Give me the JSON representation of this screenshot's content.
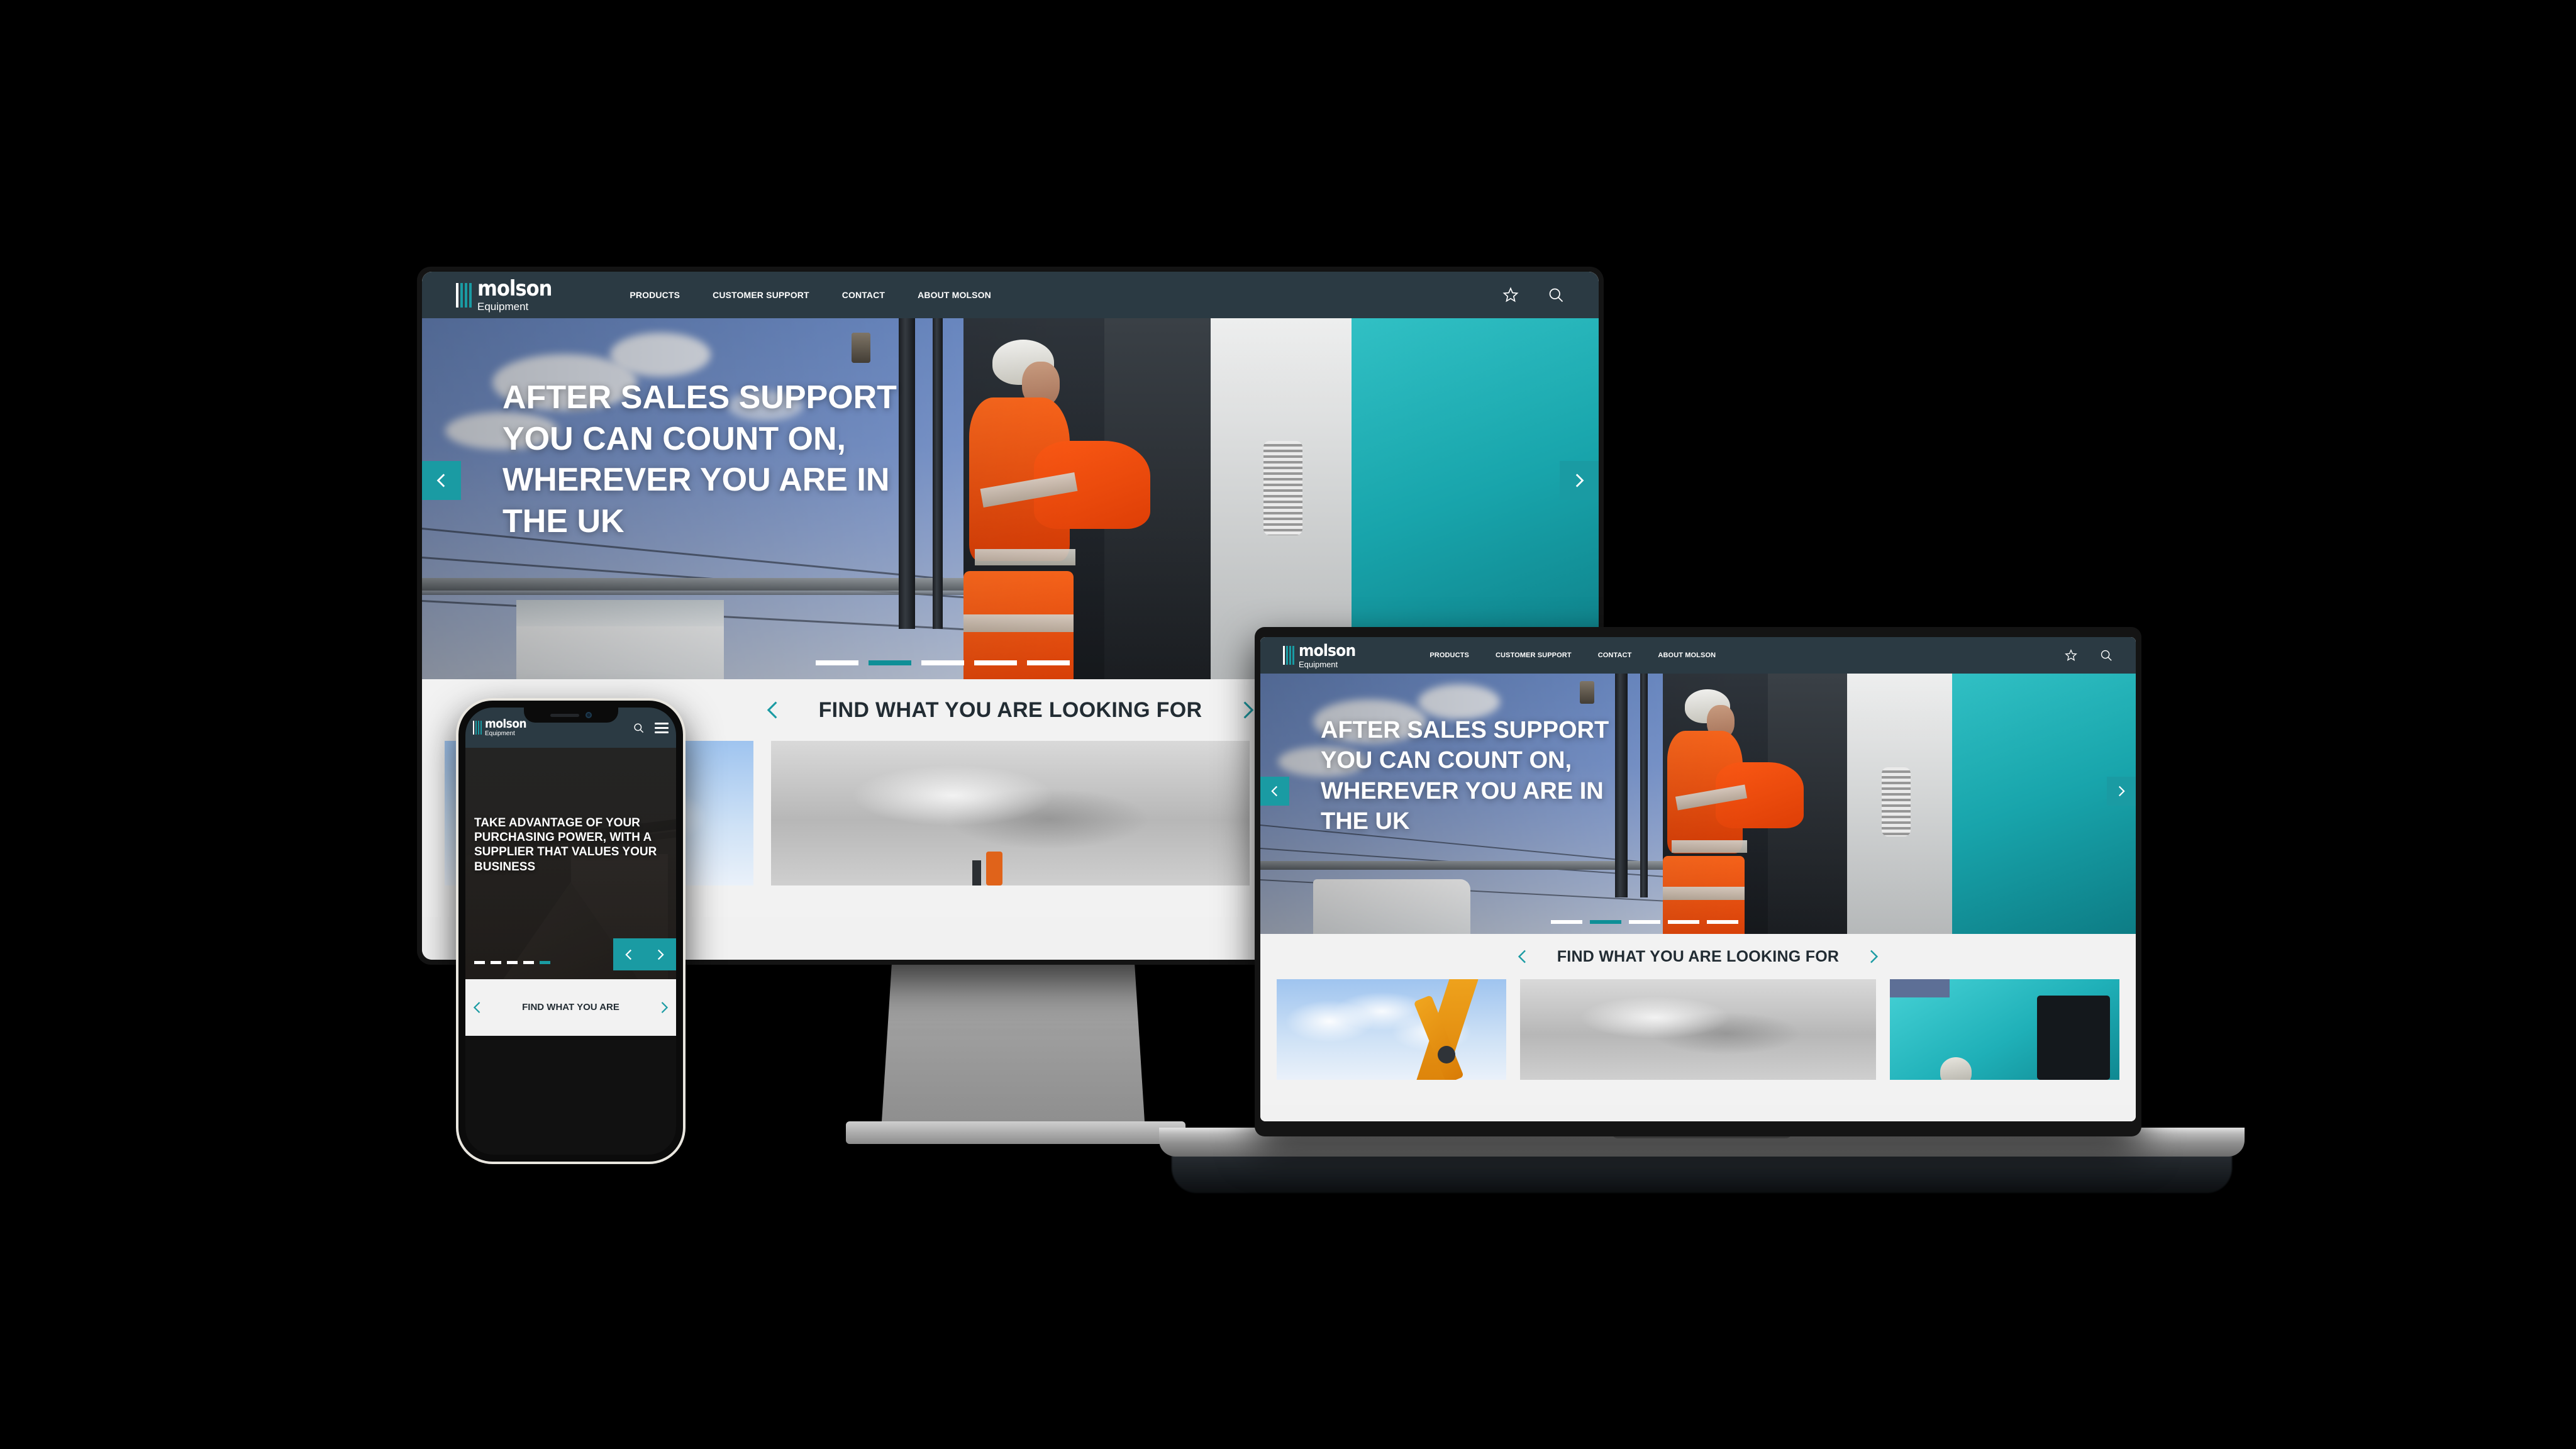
{
  "brand": {
    "name": "molson",
    "sub": "Equipment",
    "teal": "#1a9ba3",
    "header_dark": "#2b3a43",
    "band_bg": "#f2f2f2",
    "heading_dark": "#222c33"
  },
  "nav": {
    "items": [
      {
        "label": "PRODUCTS"
      },
      {
        "label": "CUSTOMER SUPPORT"
      },
      {
        "label": "CONTACT"
      },
      {
        "label": "ABOUT MOLSON"
      }
    ],
    "icons": [
      {
        "name": "star-icon",
        "glyph": "☆"
      },
      {
        "name": "search-icon",
        "glyph": "⌕"
      }
    ]
  },
  "desktop": {
    "hero": {
      "lines": [
        "AFTER SALES SUPPORT",
        "YOU CAN COUNT ON,",
        "WHEREVER YOU ARE IN",
        "THE UK"
      ],
      "prev_label": "‹",
      "next_label": "›",
      "slide_count": 5,
      "active_slide": 2
    },
    "find": {
      "title": "FIND WHAT YOU ARE LOOKING FOR",
      "prev_label": "‹",
      "next_label": "›"
    },
    "thumbs": [
      {
        "name": "orange-excavator-blue-sky"
      },
      {
        "name": "machine-grey-sky"
      },
      {
        "name": "teal-machine-cab"
      }
    ]
  },
  "laptop": {
    "hero": {
      "lines": [
        "AFTER SALES SUPPORT",
        "YOU CAN COUNT ON,",
        "WHEREVER YOU ARE IN",
        "THE UK"
      ],
      "slide_count": 5,
      "active_slide": 2
    },
    "find": {
      "title": "FIND WHAT YOU ARE LOOKING FOR",
      "prev_label": "‹",
      "next_label": "›"
    },
    "thumbs": [
      {
        "name": "orange-excavator-blue-sky"
      },
      {
        "name": "machine-grey-sky"
      },
      {
        "name": "teal-machine-cab"
      }
    ]
  },
  "phone": {
    "hero": {
      "headline": "TAKE ADVANTAGE OF YOUR PURCHASING POWER, WITH A SUPPLIER THAT VALUES YOUR BUSINESS",
      "slide_count": 5,
      "active_slide": 5,
      "prev_label": "‹",
      "next_label": "›"
    },
    "find": {
      "title": "FIND WHAT YOU ARE",
      "prev_label": "‹",
      "next_label": "›"
    },
    "icons": [
      {
        "name": "search-icon"
      },
      {
        "name": "menu-icon"
      }
    ]
  }
}
